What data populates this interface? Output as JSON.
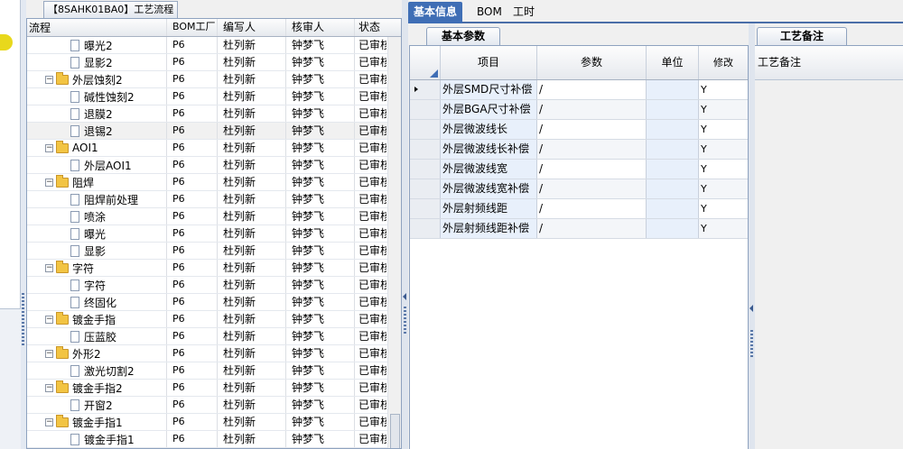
{
  "flow_tab": {
    "label": "【8SAHK01BA0】工艺流程"
  },
  "tree": {
    "columns": [
      "流程",
      "BOM工厂",
      "编写人",
      "核审人",
      "状态"
    ],
    "rows": [
      {
        "indent": 2,
        "type": "doc",
        "name": "曝光2",
        "factory": "P6",
        "writer": "杜列新",
        "reviewer": "钟梦飞",
        "status": "已审核"
      },
      {
        "indent": 2,
        "type": "doc",
        "name": "显影2",
        "factory": "P6",
        "writer": "杜列新",
        "reviewer": "钟梦飞",
        "status": "已审核"
      },
      {
        "indent": 1,
        "type": "folder",
        "name": "外层蚀刻2",
        "factory": "P6",
        "writer": "杜列新",
        "reviewer": "钟梦飞",
        "status": "已审核"
      },
      {
        "indent": 2,
        "type": "doc",
        "name": "碱性蚀刻2",
        "factory": "P6",
        "writer": "杜列新",
        "reviewer": "钟梦飞",
        "status": "已审核"
      },
      {
        "indent": 2,
        "type": "doc",
        "name": "退膜2",
        "factory": "P6",
        "writer": "杜列新",
        "reviewer": "钟梦飞",
        "status": "已审核"
      },
      {
        "indent": 2,
        "type": "doc",
        "name": "退锡2",
        "factory": "P6",
        "writer": "杜列新",
        "reviewer": "钟梦飞",
        "status": "已审核",
        "selected": true
      },
      {
        "indent": 1,
        "type": "folder",
        "name": "AOI1",
        "factory": "P6",
        "writer": "杜列新",
        "reviewer": "钟梦飞",
        "status": "已审核"
      },
      {
        "indent": 2,
        "type": "doc",
        "name": "外层AOI1",
        "factory": "P6",
        "writer": "杜列新",
        "reviewer": "钟梦飞",
        "status": "已审核"
      },
      {
        "indent": 1,
        "type": "folder",
        "name": "阻焊",
        "factory": "P6",
        "writer": "杜列新",
        "reviewer": "钟梦飞",
        "status": "已审核"
      },
      {
        "indent": 2,
        "type": "doc",
        "name": "阻焊前处理",
        "factory": "P6",
        "writer": "杜列新",
        "reviewer": "钟梦飞",
        "status": "已审核"
      },
      {
        "indent": 2,
        "type": "doc",
        "name": "喷涂",
        "factory": "P6",
        "writer": "杜列新",
        "reviewer": "钟梦飞",
        "status": "已审核"
      },
      {
        "indent": 2,
        "type": "doc",
        "name": "曝光",
        "factory": "P6",
        "writer": "杜列新",
        "reviewer": "钟梦飞",
        "status": "已审核"
      },
      {
        "indent": 2,
        "type": "doc",
        "name": "显影",
        "factory": "P6",
        "writer": "杜列新",
        "reviewer": "钟梦飞",
        "status": "已审核"
      },
      {
        "indent": 1,
        "type": "folder",
        "name": "字符",
        "factory": "P6",
        "writer": "杜列新",
        "reviewer": "钟梦飞",
        "status": "已审核"
      },
      {
        "indent": 2,
        "type": "doc",
        "name": "字符",
        "factory": "P6",
        "writer": "杜列新",
        "reviewer": "钟梦飞",
        "status": "已审核"
      },
      {
        "indent": 2,
        "type": "doc",
        "name": "终固化",
        "factory": "P6",
        "writer": "杜列新",
        "reviewer": "钟梦飞",
        "status": "已审核"
      },
      {
        "indent": 1,
        "type": "folder",
        "name": "镀金手指",
        "factory": "P6",
        "writer": "杜列新",
        "reviewer": "钟梦飞",
        "status": "已审核"
      },
      {
        "indent": 2,
        "type": "doc",
        "name": "压蓝胶",
        "factory": "P6",
        "writer": "杜列新",
        "reviewer": "钟梦飞",
        "status": "已审核"
      },
      {
        "indent": 1,
        "type": "folder",
        "name": "外形2",
        "factory": "P6",
        "writer": "杜列新",
        "reviewer": "钟梦飞",
        "status": "已审核"
      },
      {
        "indent": 2,
        "type": "doc",
        "name": "激光切割2",
        "factory": "P6",
        "writer": "杜列新",
        "reviewer": "钟梦飞",
        "status": "已审核"
      },
      {
        "indent": 1,
        "type": "folder",
        "name": "镀金手指2",
        "factory": "P6",
        "writer": "杜列新",
        "reviewer": "钟梦飞",
        "status": "已审核"
      },
      {
        "indent": 2,
        "type": "doc",
        "name": "开窗2",
        "factory": "P6",
        "writer": "杜列新",
        "reviewer": "钟梦飞",
        "status": "已审核"
      },
      {
        "indent": 1,
        "type": "folder",
        "name": "镀金手指1",
        "factory": "P6",
        "writer": "杜列新",
        "reviewer": "钟梦飞",
        "status": "已审核"
      },
      {
        "indent": 2,
        "type": "doc",
        "name": "镀金手指1",
        "factory": "P6",
        "writer": "杜列新",
        "reviewer": "钟梦飞",
        "status": "已审核"
      }
    ]
  },
  "top_tabs": [
    {
      "label": "基本信息",
      "active": true
    },
    {
      "label": "BOM",
      "active": false
    },
    {
      "label": "工时",
      "active": false
    }
  ],
  "basic_params_tab": {
    "label": "基本参数"
  },
  "param_grid": {
    "columns": [
      "项目",
      "参数",
      "单位",
      "修改"
    ],
    "rows": [
      {
        "item": "外层SMD尺寸补偿",
        "param": "/",
        "unit": "",
        "modify": "Y",
        "current": true
      },
      {
        "item": "外层BGA尺寸补偿",
        "param": "/",
        "unit": "",
        "modify": "Y"
      },
      {
        "item": "外层微波线长",
        "param": "/",
        "unit": "",
        "modify": "Y"
      },
      {
        "item": "外层微波线长补偿",
        "param": "/",
        "unit": "",
        "modify": "Y"
      },
      {
        "item": "外层微波线宽",
        "param": "/",
        "unit": "",
        "modify": "Y"
      },
      {
        "item": "外层微波线宽补偿",
        "param": "/",
        "unit": "",
        "modify": "Y"
      },
      {
        "item": "外层射频线距",
        "param": "/",
        "unit": "",
        "modify": "Y"
      },
      {
        "item": "外层射频线距补偿",
        "param": "/",
        "unit": "",
        "modify": "Y"
      }
    ]
  },
  "notes_tab": {
    "label": "工艺备注"
  },
  "notes_panel": {
    "header": "工艺备注"
  }
}
